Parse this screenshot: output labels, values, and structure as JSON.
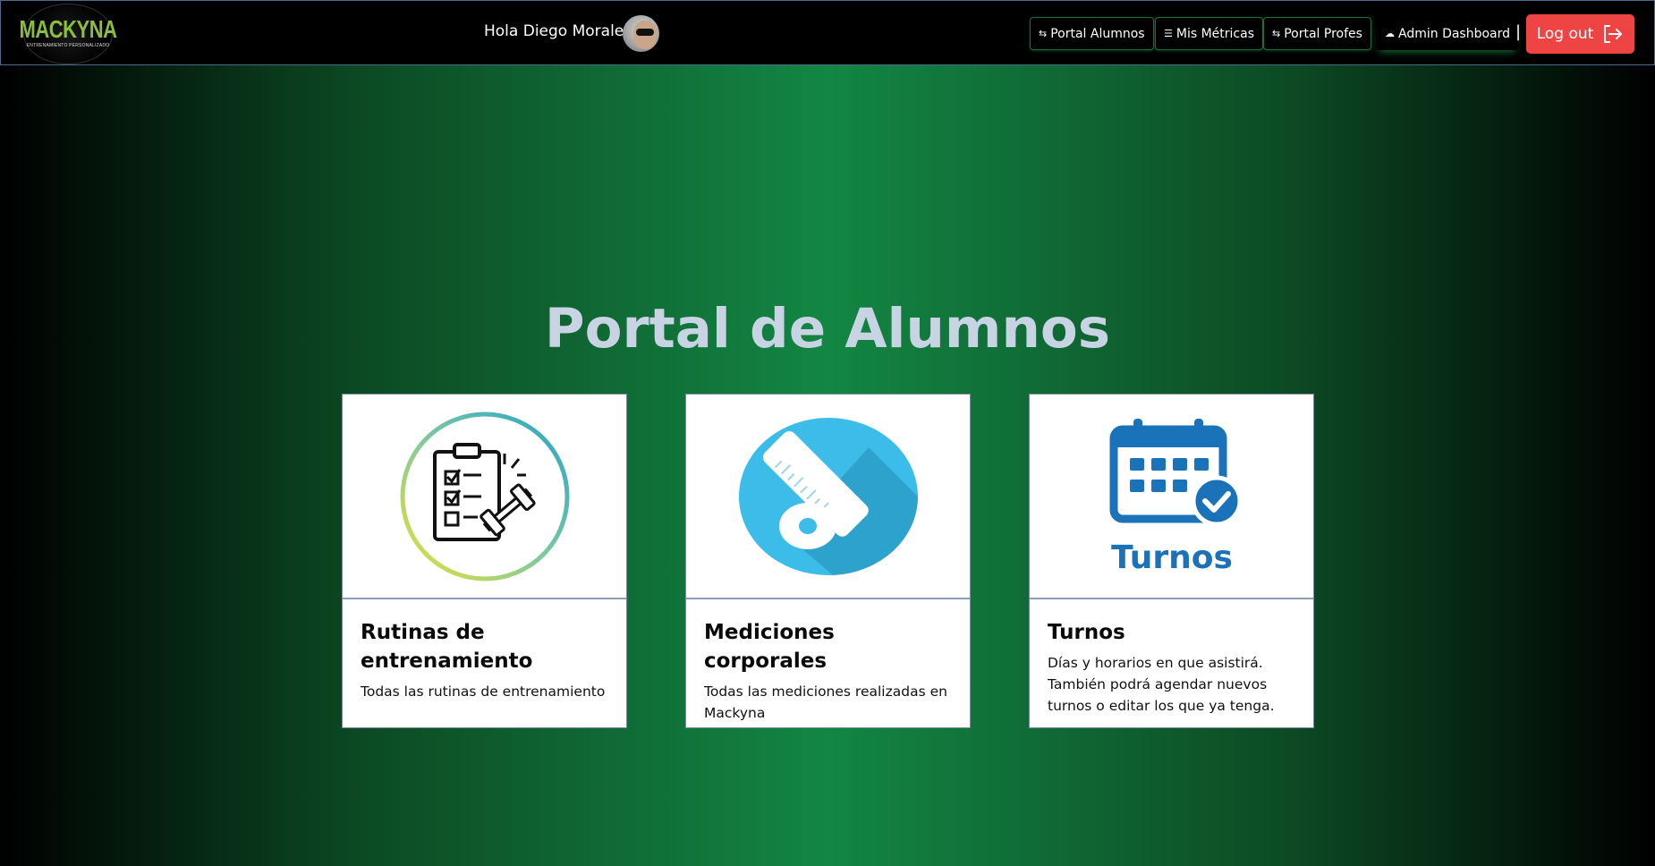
{
  "logo": {
    "brand": "MACKYNA",
    "tagline": "ENTRENAMIENTO PERSONALIZADO"
  },
  "header": {
    "greeting": "Hola Diego Morales!",
    "nav": [
      {
        "label": "Portal Alumnos",
        "icon": "portal-icon"
      },
      {
        "label": "Mis Métricas",
        "icon": "metrics-icon"
      },
      {
        "label": "Portal Profes",
        "icon": "portal-icon"
      },
      {
        "label": "Admin Dashboard",
        "icon": "cloud-icon"
      }
    ],
    "separator": "|",
    "logout_label": "Log out"
  },
  "main": {
    "title": "Portal de Alumnos",
    "cards": [
      {
        "title": "Rutinas de entrenamiento",
        "description": "Todas las rutinas de entrenamiento",
        "icon": "checklist-dumbbell-icon"
      },
      {
        "title": "Mediciones corporales",
        "description": "Todas las mediciones realizadas en Mackyna",
        "icon": "measuring-tape-icon"
      },
      {
        "title": "Turnos",
        "description": "Días y horarios en que asistirá. También podrá agendar nuevos turnos o editar los que ya tenga.",
        "icon": "calendar-check-icon",
        "image_text": "Turnos"
      }
    ]
  },
  "colors": {
    "logout": "#ef4444",
    "accent_green": "#138643",
    "title": "#c8d4e4",
    "calendar_blue": "#1a73b8",
    "tape_blue": "#3cbde9"
  }
}
